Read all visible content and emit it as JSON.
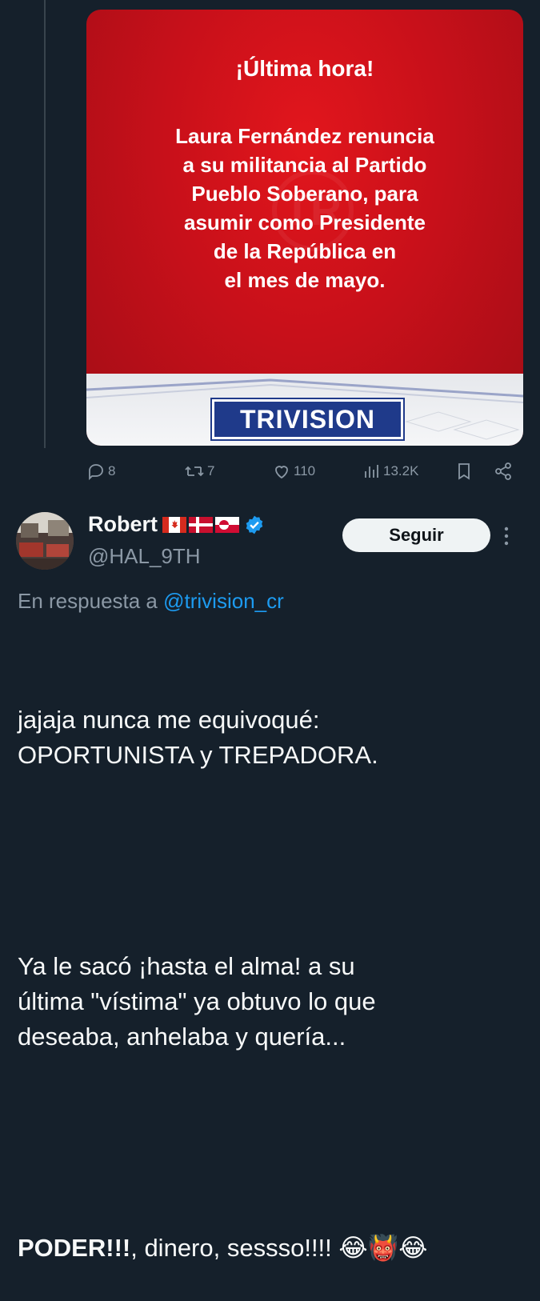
{
  "media": {
    "headline": "¡Última hora!",
    "body_lines": [
      "Laura Fernández renuncia",
      "a su militancia al Partido",
      "Pueblo Soberano, para",
      "asumir como Presidente",
      "de la República en",
      "el mes de mayo."
    ],
    "brand": "TRIVISION",
    "watermark": "TR"
  },
  "actions": {
    "replies": "8",
    "reposts": "7",
    "likes": "110",
    "views": "13.2K"
  },
  "reply": {
    "name": "Robert",
    "flags": [
      "Canada flag",
      "Denmark flag",
      "Greenland flag"
    ],
    "handle": "@HAL_9TH",
    "follow_label": "Seguir",
    "replying_prefix": "En respuesta a ",
    "replying_to": "@trivision_cr",
    "text_para1": "jajaja nunca me equivoqué:\nOPORTUNISTA y TREPADORA.",
    "text_para2": "Ya le sacó ¡hasta el alma! a su\núltima \"vístima\" ya obtuvo lo que\ndeseaba, anhelaba y quería...",
    "text_bold": "PODER!!!",
    "text_rest": ", dinero, sessso!!!! 😂👹😂"
  },
  "icons": [
    "reply-icon",
    "repost-icon",
    "like-icon",
    "views-icon",
    "bookmark-icon",
    "share-icon",
    "verified-badge-icon",
    "more-icon"
  ],
  "colors": {
    "background": "#15202b",
    "accent": "#1d9bf0",
    "muted": "#8b98a5",
    "media_red": "#c8101a",
    "brand_blue": "#1f3a8a"
  }
}
